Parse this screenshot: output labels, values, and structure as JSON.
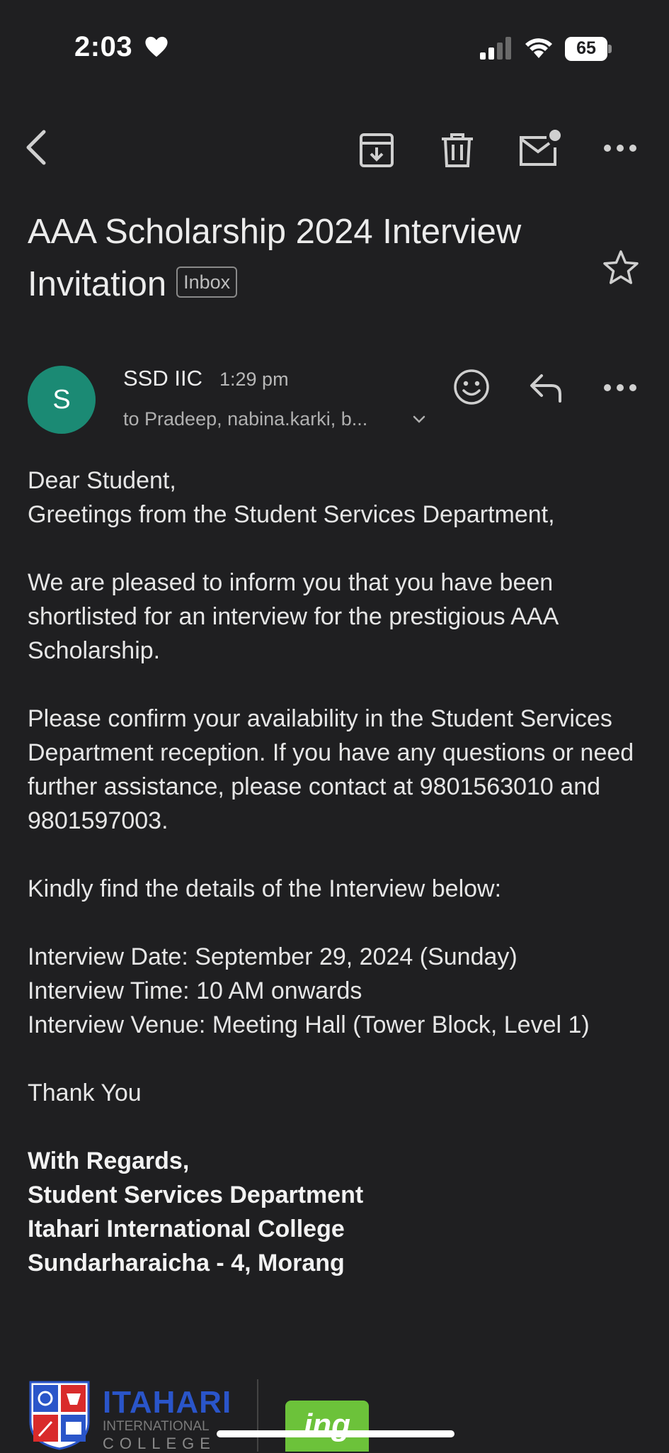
{
  "status_bar": {
    "time": "2:03",
    "battery": "65"
  },
  "email": {
    "subject": "AAA Scholarship 2024 Interview Invitation",
    "label": "Inbox",
    "sender": {
      "initial": "S",
      "name": "SSD IIC",
      "time": "1:29 pm",
      "recipients": "to Pradeep, nabina.karki, b..."
    },
    "body": {
      "greeting": [
        "Dear Student,",
        "Greetings from the Student Services Department,"
      ],
      "para1": "We are pleased to inform you that you have been shortlisted for an interview for the prestigious AAA Scholarship.",
      "para2": "Please confirm your availability in the Student Services Department reception. If you have any questions or need further assistance, please contact at 9801563010 and 9801597003.",
      "para3": "Kindly find the details of the Interview below:",
      "details": [
        "Interview Date: September 29, 2024 (Sunday)",
        "Interview Time: 10 AM onwards",
        "Interview Venue: Meeting Hall (Tower Block, Level 1)"
      ],
      "thanks": "Thank You",
      "signature": [
        "With Regards,",
        "Student Services Department",
        "Itahari International College",
        "Sundarharaicha - 4, Morang"
      ]
    },
    "logos": {
      "college_main": "ITAHARI",
      "college_sub1": "INTERNATIONAL",
      "college_sub2": "COLLEGE",
      "partner": "ing"
    }
  },
  "colors": {
    "background": "#1f1f21",
    "avatar": "#1b8a74",
    "college_blue": "#2a55c9",
    "ing_green": "#6cc23a"
  }
}
